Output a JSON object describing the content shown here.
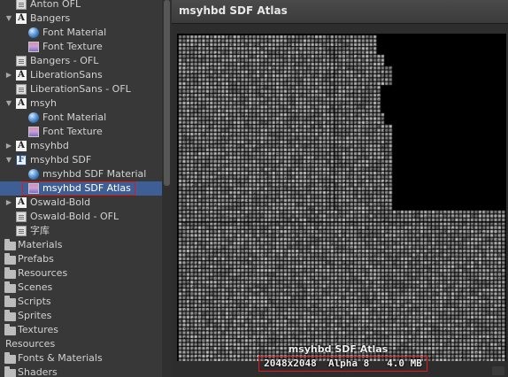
{
  "project_tree": {
    "items": [
      {
        "label": "Anton OFL",
        "icon": "doc-icon",
        "depth": 1,
        "arrow": ""
      },
      {
        "label": "Bangers",
        "icon": "font-icon",
        "depth": 1,
        "arrow": "expanded"
      },
      {
        "label": "Font Material",
        "icon": "material-icon",
        "depth": 2,
        "arrow": ""
      },
      {
        "label": "Font Texture",
        "icon": "texture-icon",
        "depth": 2,
        "arrow": ""
      },
      {
        "label": "Bangers - OFL",
        "icon": "doc-icon",
        "depth": 1,
        "arrow": ""
      },
      {
        "label": "LiberationSans",
        "icon": "font-icon",
        "depth": 1,
        "arrow": "collapsed"
      },
      {
        "label": "LiberationSans - OFL",
        "icon": "doc-icon",
        "depth": 1,
        "arrow": ""
      },
      {
        "label": "msyh",
        "icon": "font-icon",
        "depth": 1,
        "arrow": "expanded"
      },
      {
        "label": "Font Material",
        "icon": "material-icon",
        "depth": 2,
        "arrow": ""
      },
      {
        "label": "Font Texture",
        "icon": "texture-icon",
        "depth": 2,
        "arrow": ""
      },
      {
        "label": "msyhbd",
        "icon": "font-icon",
        "depth": 1,
        "arrow": "collapsed"
      },
      {
        "label": "msyhbd SDF",
        "icon": "sdf-font-icon",
        "depth": 1,
        "arrow": "expanded"
      },
      {
        "label": "msyhbd SDF Material",
        "icon": "material-icon",
        "depth": 2,
        "arrow": ""
      },
      {
        "label": "msyhbd SDF Atlas",
        "icon": "texture-icon",
        "depth": 2,
        "arrow": "",
        "selected": true
      },
      {
        "label": "Oswald-Bold",
        "icon": "font-icon",
        "depth": 1,
        "arrow": "collapsed"
      },
      {
        "label": "Oswald-Bold - OFL",
        "icon": "doc-icon",
        "depth": 1,
        "arrow": ""
      },
      {
        "label": "字库",
        "icon": "doc-icon",
        "depth": 1,
        "arrow": ""
      },
      {
        "label": "Materials",
        "icon": "folder-icon",
        "depth": 0,
        "arrow": ""
      },
      {
        "label": "Prefabs",
        "icon": "folder-icon",
        "depth": 0,
        "arrow": ""
      },
      {
        "label": "Resources",
        "icon": "folder-icon",
        "depth": 0,
        "arrow": ""
      },
      {
        "label": "Scenes",
        "icon": "folder-icon",
        "depth": 0,
        "arrow": ""
      },
      {
        "label": "Scripts",
        "icon": "folder-icon",
        "depth": 0,
        "arrow": ""
      },
      {
        "label": "Sprites",
        "icon": "folder-icon",
        "depth": 0,
        "arrow": ""
      },
      {
        "label": "Textures",
        "icon": "folder-icon",
        "depth": 0,
        "arrow": ""
      },
      {
        "label": "Resources",
        "icon": "folder-icon",
        "depth": -1,
        "arrow": ""
      },
      {
        "label": "Fonts & Materials",
        "icon": "folder-icon",
        "depth": 0,
        "arrow": ""
      },
      {
        "label": "Shaders",
        "icon": "folder-icon",
        "depth": 0,
        "arrow": ""
      }
    ]
  },
  "preview": {
    "title": "msyhbd SDF Atlas",
    "atlas_name": "msyhbd SDF Atlas",
    "texture_info": "2048x2048  Alpha 8   4.0 MB"
  },
  "colors": {
    "selection": "#3e5f96",
    "highlight_border": "#e01818"
  }
}
